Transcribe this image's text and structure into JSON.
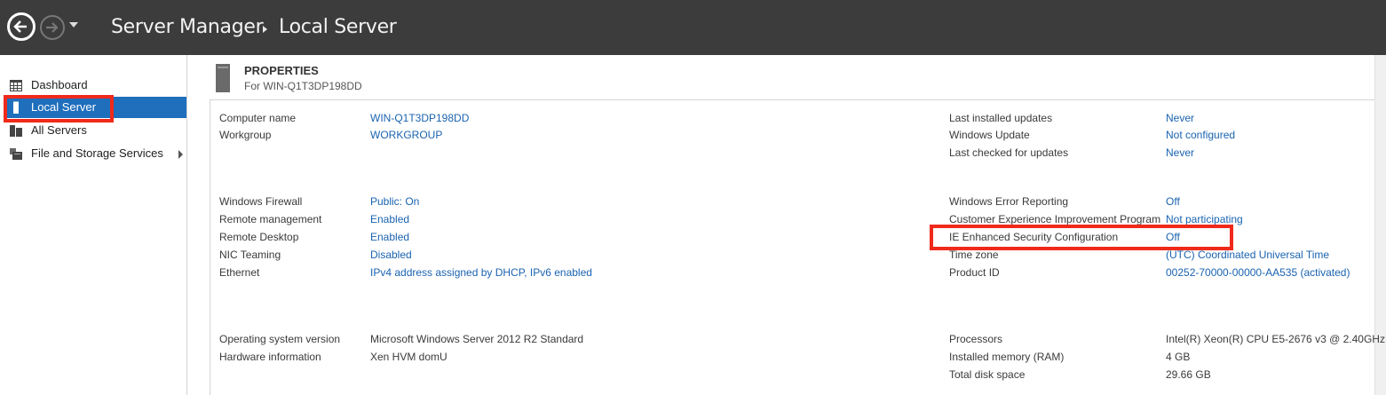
{
  "titlebar": {
    "breadcrumb_app": "Server Manager",
    "breadcrumb_page": "Local Server"
  },
  "sidebar": {
    "items": [
      {
        "label": "Dashboard",
        "icon": "dashboard-icon"
      },
      {
        "label": "Local Server",
        "icon": "server-icon",
        "active": true
      },
      {
        "label": "All Servers",
        "icon": "servers-icon"
      },
      {
        "label": "File and Storage Services",
        "icon": "storage-icon",
        "has_submenu": true
      }
    ]
  },
  "properties": {
    "title": "PROPERTIES",
    "subtitle": "For WIN-Q1T3DP198DD"
  },
  "left_groups": [
    [
      {
        "label": "Computer name",
        "value": "WIN-Q1T3DP198DD",
        "link": true
      },
      {
        "label": "Workgroup",
        "value": "WORKGROUP",
        "link": true
      }
    ],
    [
      {
        "label": "Windows Firewall",
        "value": "Public: On",
        "link": true
      },
      {
        "label": "Remote management",
        "value": "Enabled",
        "link": true
      },
      {
        "label": "Remote Desktop",
        "value": "Enabled",
        "link": true
      },
      {
        "label": "NIC Teaming",
        "value": "Disabled",
        "link": true
      },
      {
        "label": "Ethernet",
        "value": "IPv4 address assigned by DHCP, IPv6 enabled",
        "link": true
      }
    ],
    [
      {
        "label": "Operating system version",
        "value": "Microsoft Windows Server 2012 R2 Standard",
        "link": false
      },
      {
        "label": "Hardware information",
        "value": "Xen HVM domU",
        "link": false
      }
    ]
  ],
  "right_groups": [
    [
      {
        "label": "Last installed updates",
        "value": "Never",
        "link": true
      },
      {
        "label": "Windows Update",
        "value": "Not configured",
        "link": true
      },
      {
        "label": "Last checked for updates",
        "value": "Never",
        "link": true
      }
    ],
    [
      {
        "label": "Windows Error Reporting",
        "value": "Off",
        "link": true
      },
      {
        "label": "Customer Experience Improvement Program",
        "value": "Not participating",
        "link": true
      },
      {
        "label": "IE Enhanced Security Configuration",
        "value": "Off",
        "link": true
      },
      {
        "label": "Time zone",
        "value": "(UTC) Coordinated Universal Time",
        "link": true
      },
      {
        "label": "Product ID",
        "value": "00252-70000-00000-AA535 (activated)",
        "link": true
      }
    ],
    [
      {
        "label": "Processors",
        "value": "Intel(R) Xeon(R) CPU E5-2676 v3 @ 2.40GHz",
        "link": false
      },
      {
        "label": "Installed memory (RAM)",
        "value": "4 GB",
        "link": false
      },
      {
        "label": "Total disk space",
        "value": "29.66 GB",
        "link": false
      }
    ]
  ],
  "colors": {
    "titlebar": "#3c3c3c",
    "active_item": "#1f6fbd",
    "link": "#1a63b0",
    "highlight": "#f02a1a"
  }
}
